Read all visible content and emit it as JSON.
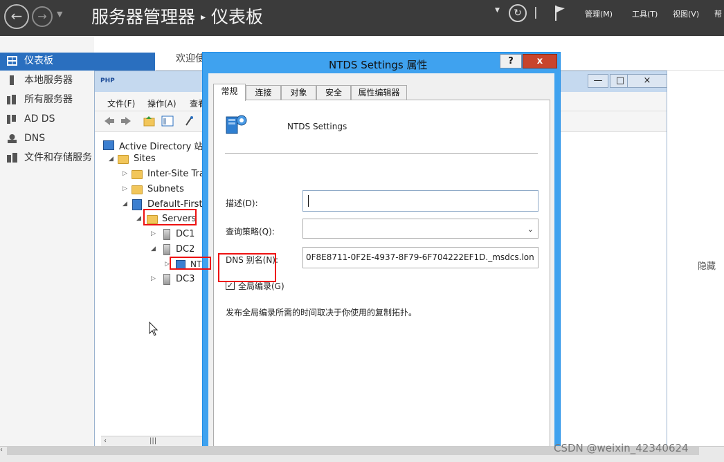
{
  "window": {
    "title_app": "服务器管理器",
    "title_page": "仪表板",
    "menus": [
      "管理(M)",
      "工具(T)",
      "视图(V)",
      "帮"
    ]
  },
  "sidebar": {
    "items": [
      {
        "label": "仪表板",
        "icon": "dashboard-icon"
      },
      {
        "label": "本地服务器",
        "icon": "server-icon"
      },
      {
        "label": "所有服务器",
        "icon": "servers-icon"
      },
      {
        "label": "AD DS",
        "icon": "ad-ds-icon"
      },
      {
        "label": "DNS",
        "icon": "dns-icon"
      },
      {
        "label": "文件和存储服务",
        "icon": "storage-icon"
      }
    ]
  },
  "dashboard": {
    "welcome": "欢迎使",
    "hide": "隐藏"
  },
  "sites_window": {
    "logo": "PHP",
    "menus": [
      "文件(F)",
      "操作(A)",
      "查看"
    ],
    "tree": {
      "root": "Active Directory 站点",
      "sites": "Sites",
      "inter_site": "Inter-Site Tra",
      "subnets": "Subnets",
      "default_site": "Default-First-",
      "servers": "Servers",
      "dc1": "DC1",
      "dc2": "DC2",
      "nt": "NT",
      "dc3": "DC3"
    }
  },
  "dialog": {
    "title": "NTDS Settings 属性",
    "help": "?",
    "close": "x",
    "tabs": [
      "常规",
      "连接",
      "对象",
      "安全",
      "属性编辑器"
    ],
    "object_name": "NTDS Settings",
    "description_label": "描述(D):",
    "description_value": "",
    "query_policy_label": "查询策略(Q):",
    "query_policy_value": "",
    "dns_alias_label": "DNS 别名(N):",
    "dns_alias_value": "0F8E8711-0F2E-4937-8F79-6F704222EF1D._msdcs.lon",
    "gc_label": "全局编录(G)",
    "gc_checked": true,
    "gc_description": "发布全局编录所需的时间取决于你使用的复制拓扑。"
  },
  "watermark": "CSDN @weixin_42340624",
  "colors": {
    "accent": "#2a6fbf",
    "dialog_frame": "#3fa2ef",
    "close_red": "#c8442c",
    "annotation": "#ee1111"
  }
}
